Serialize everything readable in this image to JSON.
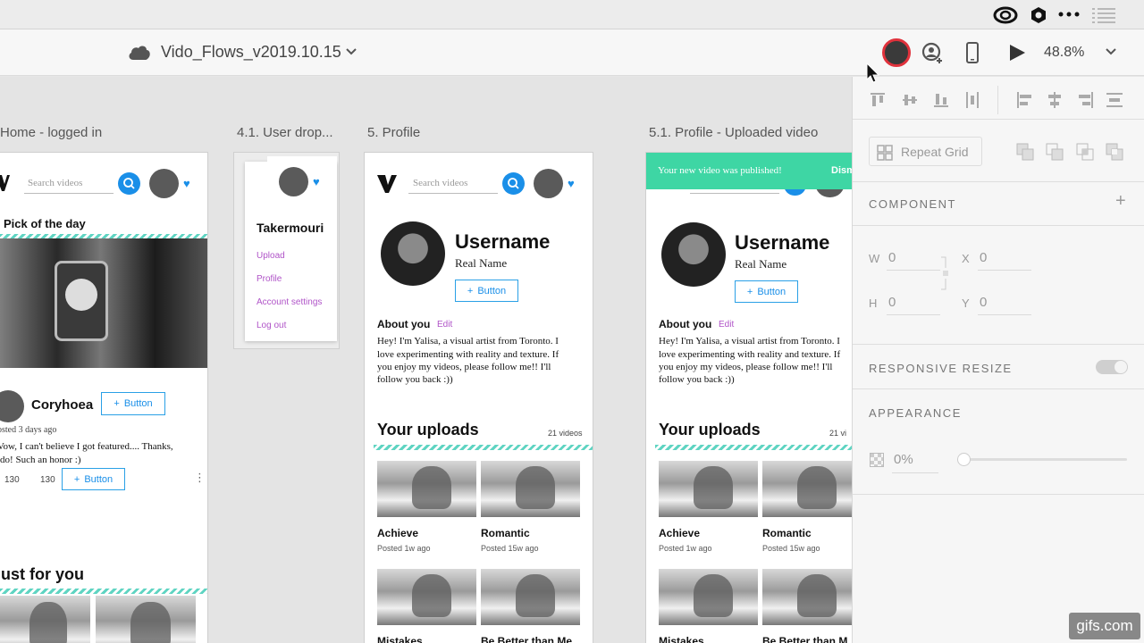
{
  "app": {
    "document_title": "Vido_Flows_v2019.10.15",
    "zoom": "48.8%"
  },
  "artboards": {
    "home": {
      "label": "Home - logged in",
      "search_placeholder": "Search videos",
      "pick_title": "Pick of the day",
      "author": "Coryhoea",
      "button_label": "Button",
      "posted": "osted 3 days ago",
      "comment_line1": "Vow, I can't believe I got featured.... Thanks,",
      "comment_line2": "ido! Such an honor :)",
      "likes": "130",
      "views": "130",
      "action_button": "Button",
      "just_for_you": "ust for you"
    },
    "dropdown": {
      "label": "4.1. User drop...",
      "username": "Takermouri",
      "items": [
        "Upload",
        "Profile",
        "Account settings",
        "Log out"
      ]
    },
    "profile": {
      "label": "5. Profile",
      "search_placeholder": "Search videos",
      "username": "Username",
      "real_name": "Real Name",
      "button_label": "Button",
      "about_title": "About you",
      "edit_label": "Edit",
      "bio": [
        "Hey! I'm Yalisa, a visual artist from Toronto. I",
        "love experimenting with reality and texture. If",
        "you enjoy my videos, please follow me!! I'll",
        "follow you back :))"
      ],
      "uploads_title": "Your uploads",
      "uploads_count": "21 videos",
      "videos": [
        {
          "title": "Achieve",
          "meta": "Posted 1w ago"
        },
        {
          "title": "Romantic",
          "meta": "Posted 15w ago"
        },
        {
          "title": "Mistakes",
          "meta": ""
        },
        {
          "title": "Be Better than Me",
          "meta": ""
        }
      ]
    },
    "profile_uploaded": {
      "label": "5.1. Profile - Uploaded video",
      "toast": "Your new video was published!",
      "toast_action": "Dism",
      "username": "Username",
      "real_name": "Real Name",
      "button_label": "Button",
      "about_title": "About you",
      "edit_label": "Edit",
      "bio": [
        "Hey! I'm Yalisa, a visual artist from Toronto. I",
        "love experimenting with reality and texture. If",
        "you enjoy my videos, please follow me!! I'll",
        "follow you back :))"
      ],
      "uploads_title": "Your uploads",
      "uploads_count": "21 vi",
      "videos": [
        {
          "title": "Achieve",
          "meta": "Posted 1w ago"
        },
        {
          "title": "Romantic",
          "meta": "Posted 15w ago"
        },
        {
          "title": "Mistakes",
          "meta": ""
        },
        {
          "title": "Be Better than M",
          "meta": ""
        }
      ]
    }
  },
  "inspector": {
    "repeat_grid": "Repeat Grid",
    "component_heading": "COMPONENT",
    "w_label": "W",
    "w_value": "0",
    "x_label": "X",
    "x_value": "0",
    "h_label": "H",
    "h_value": "0",
    "y_label": "Y",
    "y_value": "0",
    "responsive_heading": "RESPONSIVE RESIZE",
    "appearance_heading": "APPEARANCE",
    "opacity_value": "0%",
    "opacity_fraction": 0
  },
  "watermark": "gifs.com",
  "colors": {
    "accent_blue": "#1a8fe8",
    "link_purple": "#b054c8",
    "toast_green": "#3ed6a4",
    "wave_teal": "#5fd4c2"
  }
}
